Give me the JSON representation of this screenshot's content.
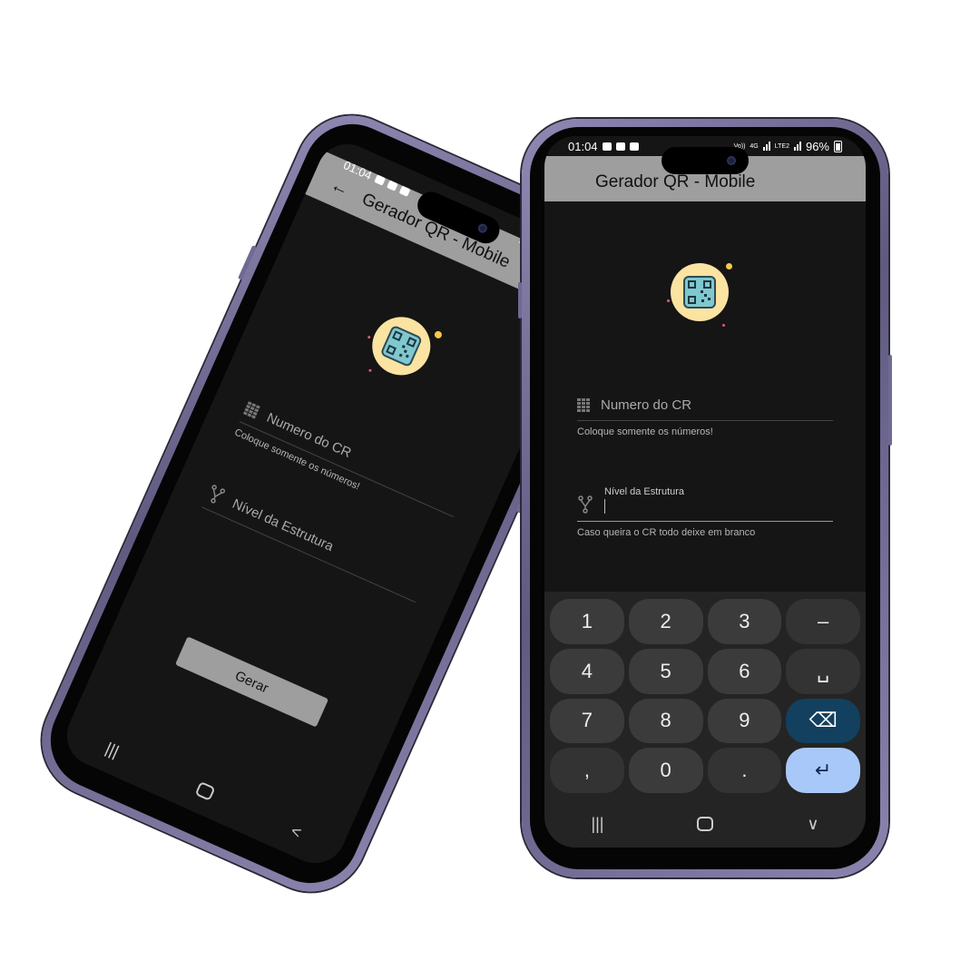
{
  "status": {
    "time": "01:04",
    "operator": "Vo))",
    "net": "4G",
    "lte": "LTE1",
    "lte2": "LTE2",
    "battery": "96%"
  },
  "app": {
    "title": "Gerador QR - Mobile"
  },
  "form": {
    "cr_label": "Numero do CR",
    "cr_helper": "Coloque somente os números!",
    "nivel_label": "Nível da Estrutura",
    "nivel_helper": "Caso queira o CR todo deixe em branco",
    "generate": "Gerar"
  },
  "nav": {
    "recents": "|||",
    "home": "",
    "back": "<",
    "down": "∨"
  },
  "keyboard": {
    "keys": [
      "1",
      "2",
      "3",
      "–",
      "4",
      "5",
      "6",
      "␣",
      "7",
      "8",
      "9",
      "⌫",
      ",",
      "0",
      ".",
      "↵"
    ]
  },
  "colors": {
    "appbar": "#9e9e9e",
    "screen": "#151515",
    "frame": "#7f79a5",
    "enter_key": "#a9c8fa",
    "delete_key": "#12405e"
  }
}
